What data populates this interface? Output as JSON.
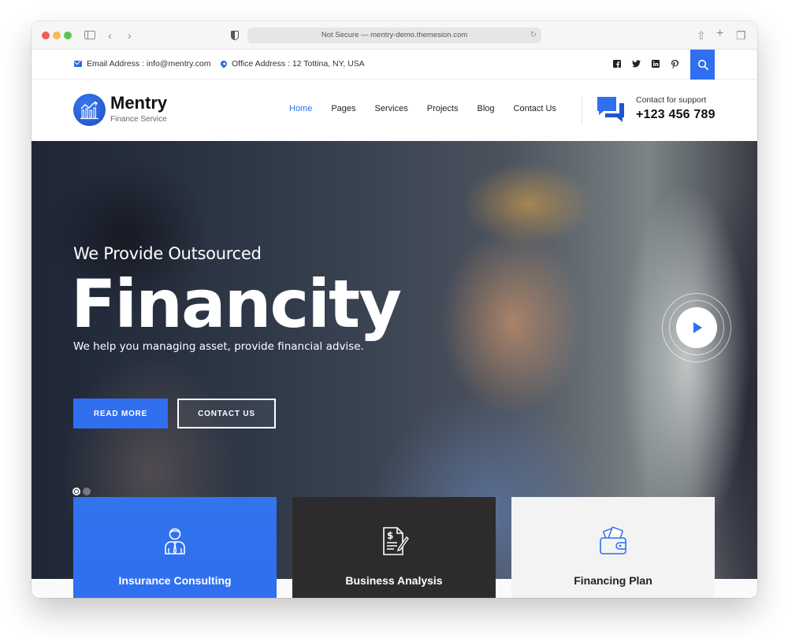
{
  "browser": {
    "address": "Not Secure — mentry-demo.themesion.com",
    "icons": [
      "sidebar-icon",
      "back-icon",
      "forward-icon",
      "shield-icon",
      "reload-icon",
      "share-icon",
      "new-tab-icon",
      "tabs-icon"
    ]
  },
  "topbar": {
    "email": "Email Address : info@mentry.com",
    "office": "Office Address : 12 Tottina, NY, USA",
    "social": [
      {
        "name": "facebook-icon",
        "glyph": "f"
      },
      {
        "name": "twitter-icon",
        "glyph": "t"
      },
      {
        "name": "linkedin-icon",
        "glyph": "in"
      },
      {
        "name": "pinterest-icon",
        "glyph": "p"
      }
    ],
    "search_icon": "search-icon"
  },
  "header": {
    "logo_name": "Mentry",
    "logo_tagline": "Finance Service",
    "nav": [
      {
        "label": "Home",
        "active": true
      },
      {
        "label": "Pages",
        "active": false
      },
      {
        "label": "Services",
        "active": false
      },
      {
        "label": "Projects",
        "active": false
      },
      {
        "label": "Blog",
        "active": false
      },
      {
        "label": "Contact Us",
        "active": false
      }
    ],
    "support_label": "Contact for support",
    "support_phone": "+123 456 789"
  },
  "hero": {
    "kicker": "We Provide Outsourced",
    "title": "Financity",
    "subtitle": "We help you managing asset, provide financial advise.",
    "primary_button": "READ MORE",
    "secondary_button": "CONTACT US",
    "slides": {
      "current": 1,
      "total": 2
    }
  },
  "services": [
    {
      "title": "Insurance Consulting",
      "icon": "consultant-icon"
    },
    {
      "title": "Business Analysis",
      "icon": "invoice-pen-icon"
    },
    {
      "title": "Financing Plan",
      "icon": "wallet-icon"
    }
  ],
  "colors": {
    "accent": "#2f6ff0",
    "dark_card": "#2d2b2c",
    "light_card": "#f4f3f4"
  }
}
